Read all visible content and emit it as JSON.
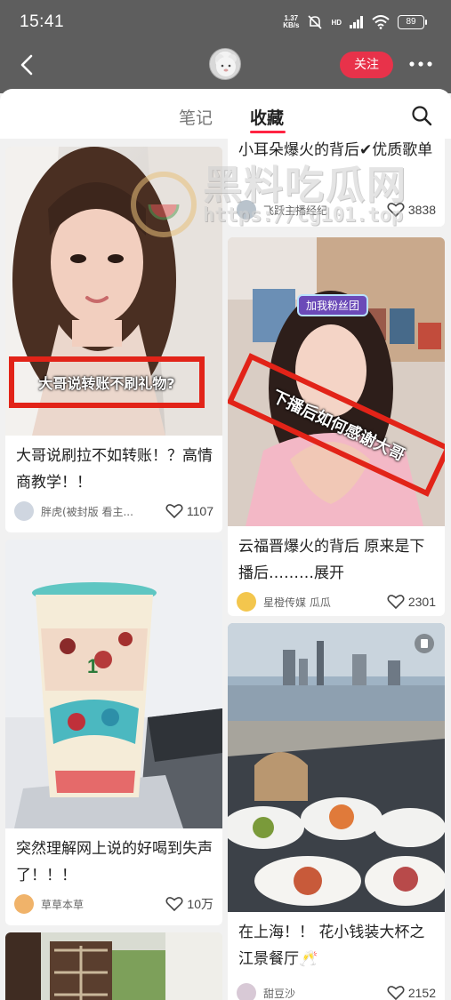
{
  "status_bar": {
    "time": "15:41",
    "net_speed_value": "1.37",
    "net_speed_unit": "KB/s",
    "hd": "HD",
    "battery": "89"
  },
  "nav": {
    "follow_label": "关注"
  },
  "tabs": [
    {
      "label": "笔记",
      "active": false
    },
    {
      "label": "收藏",
      "active": true
    }
  ],
  "watermark": {
    "site_name": "黑料吃瓜网",
    "url": "https://cg101.top"
  },
  "cards": [
    {
      "overlay_text": "大哥说转账不刷礼物?",
      "title": "大哥说刷拉不如转账！？高情商教学！！",
      "author": "胖虎(被封版 看主...",
      "likes": "1107"
    },
    {
      "title": "小耳朵爆火的背后✔优质歌单",
      "author": "飞跃主播经纪",
      "likes": "3838"
    },
    {
      "sign_text": "加我粉丝团",
      "overlay_text": "下播后如何感谢大哥",
      "title": "云福晋爆火的背后 原来是下播后………展开",
      "author": "星橙传媒 瓜瓜",
      "likes": "2301"
    },
    {
      "title": "突然理解网上说的好喝到失声了！！！",
      "author": "草草本草",
      "likes": "10万"
    },
    {
      "title": "在上海！！ 花小钱装大杯之江景餐厅🥂",
      "author": "甜豆沙",
      "likes": "2152"
    }
  ],
  "colors": {
    "accent": "#ff2442",
    "follow_button": "#e8324a",
    "topbar": "#5e5e5e",
    "red_box": "#e22318"
  }
}
